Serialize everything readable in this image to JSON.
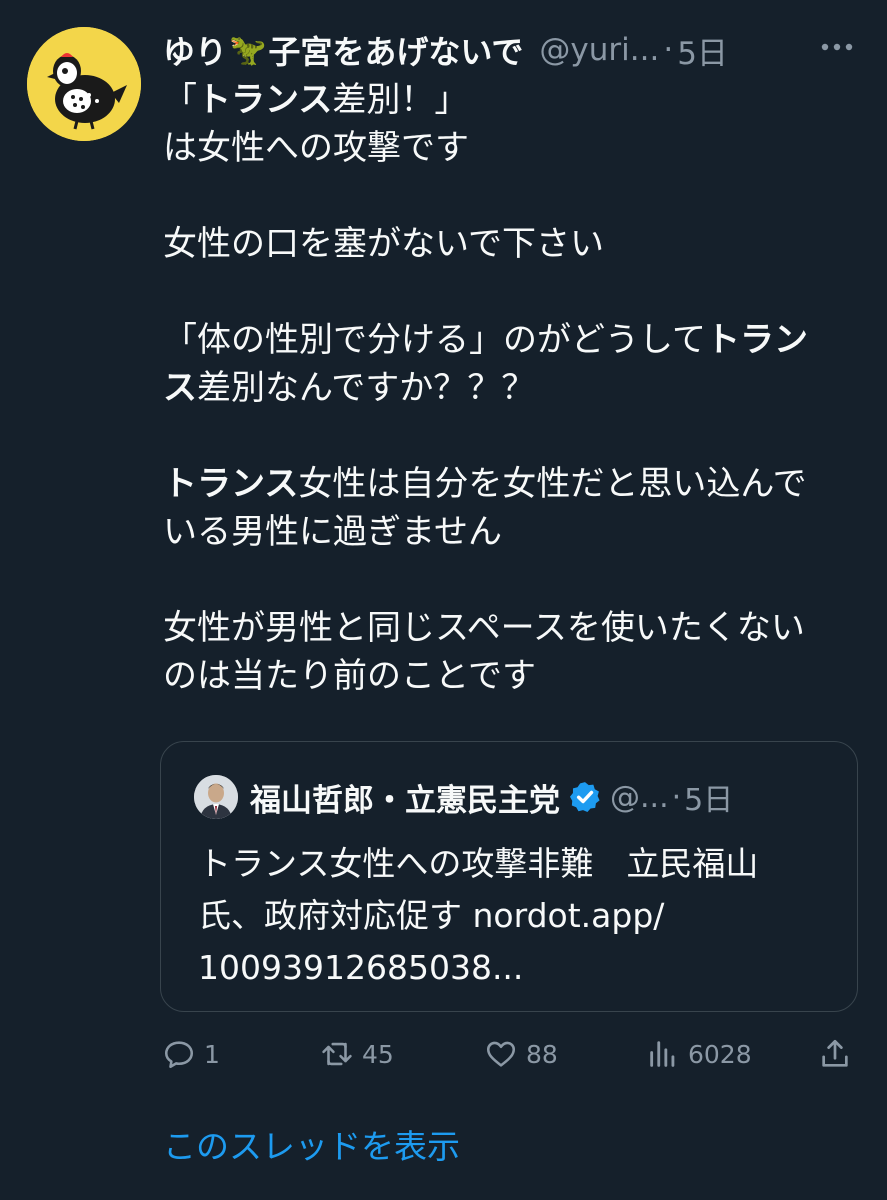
{
  "tweet": {
    "author_name": "ゆり",
    "author_name_suffix": "子宮をあげないで",
    "emoji_name": "dinosaur-emoji",
    "emoji_glyph": "🦖",
    "handle": "@yuri...",
    "dot": "·",
    "time": "5日",
    "lines": [
      [
        {
          "t": "「",
          "b": false
        },
        {
          "t": "トランス",
          "b": true
        },
        {
          "t": "差別！」",
          "b": false
        }
      ],
      [
        {
          "t": "は女性への攻撃です",
          "b": false
        }
      ],
      [],
      [
        {
          "t": "女性の口を塞がないで下さい",
          "b": false
        }
      ],
      [],
      [
        {
          "t": "「体の性別で分ける」のがどうして",
          "b": false
        },
        {
          "t": "トラン",
          "b": true
        }
      ],
      [
        {
          "t": "ス",
          "b": true
        },
        {
          "t": "差別なんですか？？？",
          "b": false
        }
      ],
      [],
      [
        {
          "t": "トランス",
          "b": true
        },
        {
          "t": "女性は自分を女性だと思い込んで",
          "b": false
        }
      ],
      [
        {
          "t": "いる男性に過ぎません",
          "b": false
        }
      ],
      [],
      [
        {
          "t": "女性が男性と同じスペースを使いたくない",
          "b": false
        }
      ],
      [
        {
          "t": "のは当たり前のことです",
          "b": false
        }
      ]
    ]
  },
  "quote": {
    "author_name": "福山哲郎・立憲民主党",
    "handle": "@...",
    "dot": "·",
    "time": "5日",
    "lines": [
      "トランス女性への攻撃非難　立民福山",
      "氏、政府対応促す  nordot.app/",
      "10093912685038..."
    ]
  },
  "actions": {
    "reply_count": "1",
    "retweet_count": "45",
    "like_count": "88",
    "views_count": "6028"
  },
  "thread_link": "このスレッドを表示",
  "colors": {
    "background": "#15202b",
    "text": "#f7f9f9",
    "secondary": "#8b98a5",
    "link": "#1d9bf0",
    "verified": "#1d9bf0",
    "avatar_bg": "#f3d64a"
  }
}
